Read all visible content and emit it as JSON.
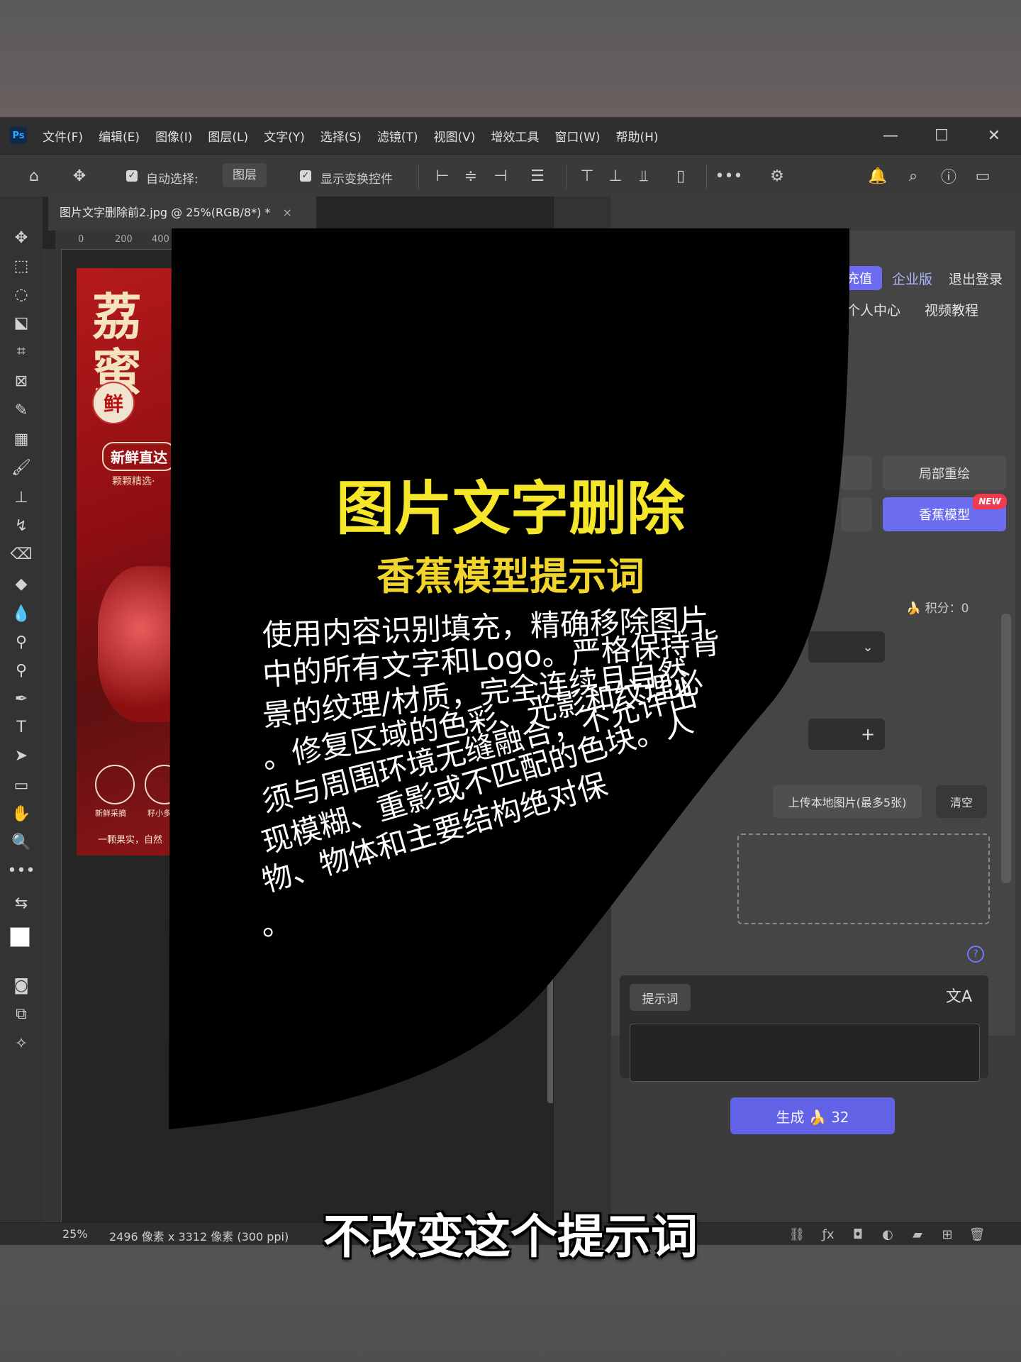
{
  "menu": {
    "logo": "Ps",
    "items": [
      "文件(F)",
      "编辑(E)",
      "图像(I)",
      "图层(L)",
      "文字(Y)",
      "选择(S)",
      "滤镜(T)",
      "视图(V)",
      "增效工具",
      "窗口(W)",
      "帮助(H)"
    ]
  },
  "options": {
    "auto_select_label": "自动选择:",
    "auto_select_value": "图层",
    "show_transform_label": "显示变换控件"
  },
  "document": {
    "tab_title": "图片文字删除前2.jpg @ 25%(RGB/8*) *",
    "ruler_ticks": [
      "0",
      "200",
      "400"
    ]
  },
  "poster": {
    "title": "荔\n蜜",
    "badge": "鲜",
    "pill": "新鲜直达",
    "sub": "颗颗精选·",
    "caption_1": "新鲜采摘",
    "caption_2": "籽小多",
    "footer": "一颗果实，自然"
  },
  "panel": {
    "recharge": "充值",
    "enterprise": "企业版",
    "logout": "退出登录",
    "personal": "个人中心",
    "tutorial": "视频教程",
    "inpaint": "局部重绘",
    "banana_model": "香蕉模型",
    "new_badge": "NEW",
    "points": "🍌 积分：0",
    "upload": "上传本地图片(最多5张)",
    "clear": "清空",
    "prompt_label": "提示词",
    "generate": "生成 🍌 32"
  },
  "status": {
    "zoom": "25%",
    "doc_info": "2496 像素 x 3312 像素 (300 ppi)"
  },
  "overlay": {
    "title": "图片文字删除",
    "subtitle": "香蕉模型提示词",
    "lines": [
      "使用内容识别填充，精确移除图片",
      "中的所有文字和Logo。严格保持背",
      "景的纹理/材质，完全连续且自然",
      "。修复区域的色彩、光影和纹理必",
      "须与周围环境无缝融合，不允许出",
      "现模糊、重影或不匹配的色块。人",
      "物、物体和主要结构绝对保",
      "。"
    ]
  },
  "caption": "不改变这个提示词"
}
